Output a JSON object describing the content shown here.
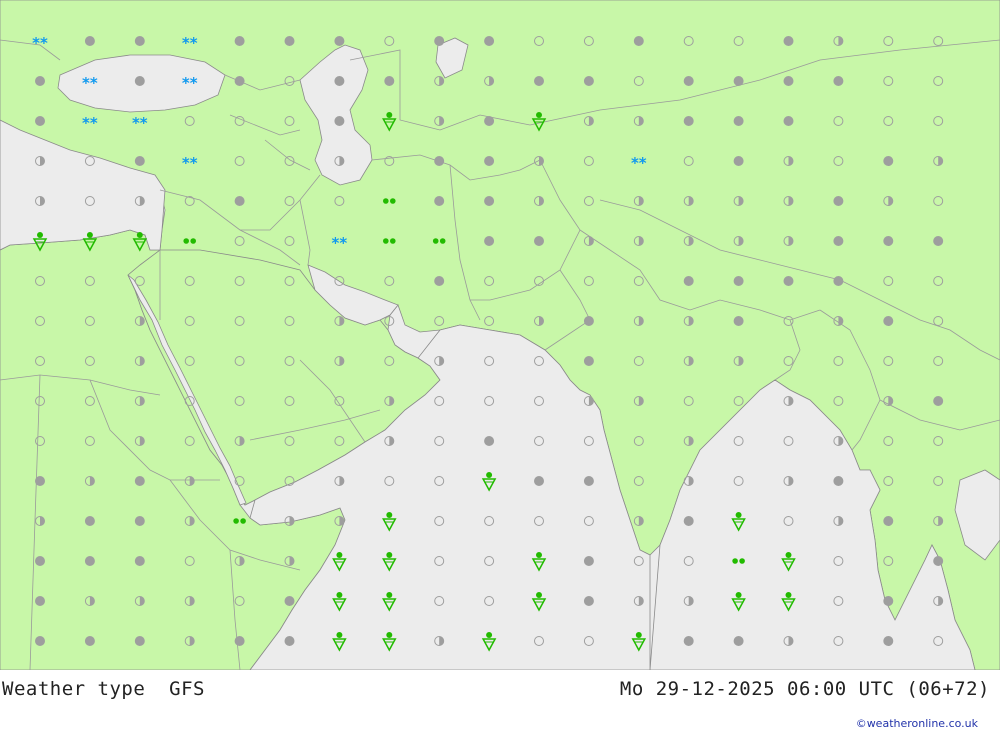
{
  "header": {
    "title": "Weather type  GFS",
    "datetime": "Mo 29-12-2025 06:00 UTC (06+72)",
    "credit": "©weatheronline.co.uk"
  },
  "colors": {
    "land": "#c8f7a8",
    "sea": "#ececec",
    "border": "#9a9a9a",
    "coast": "#888888",
    "cloud_gray": "#9e9e9e",
    "clear_outline": "#9e9e9e",
    "rain_green": "#22bb00",
    "snow_blue": "#1199ee"
  },
  "legend_symbols": {
    "o": "clear-sky-icon",
    "h": "partly-cloudy-icon",
    "c": "overcast-icon",
    "r": "rain-shower-icon",
    "d": "drizzle-icon",
    "t": "heavy-rain-icon",
    "s": "snow-icon",
    "n": "snow-shower-icon"
  },
  "weather_grid": [
    "sccscccoccoocoochoo",
    "cscscocchhccoccccoo",
    "cssooocrhcrhhcccooo",
    "hocsoohocchosochoch",
    "hohocoodcchohhhhcho",
    "rrrdoosddcchhhhhccc",
    "oooooooocooooccccoo",
    "oohooohooohchhcohco",
    "oohooohohoocohhoooo",
    "oohoooohooohhoohohc",
    "oohohoohocooohoohoo",
    "chchoohoorccohohcoo",
    "hcchdhhroooohcrohch",
    "cccohhrroorcoodrooc",
    "chhhocrroorchhrroch",
    "ccchccrrhroorcchoco"
  ]
}
